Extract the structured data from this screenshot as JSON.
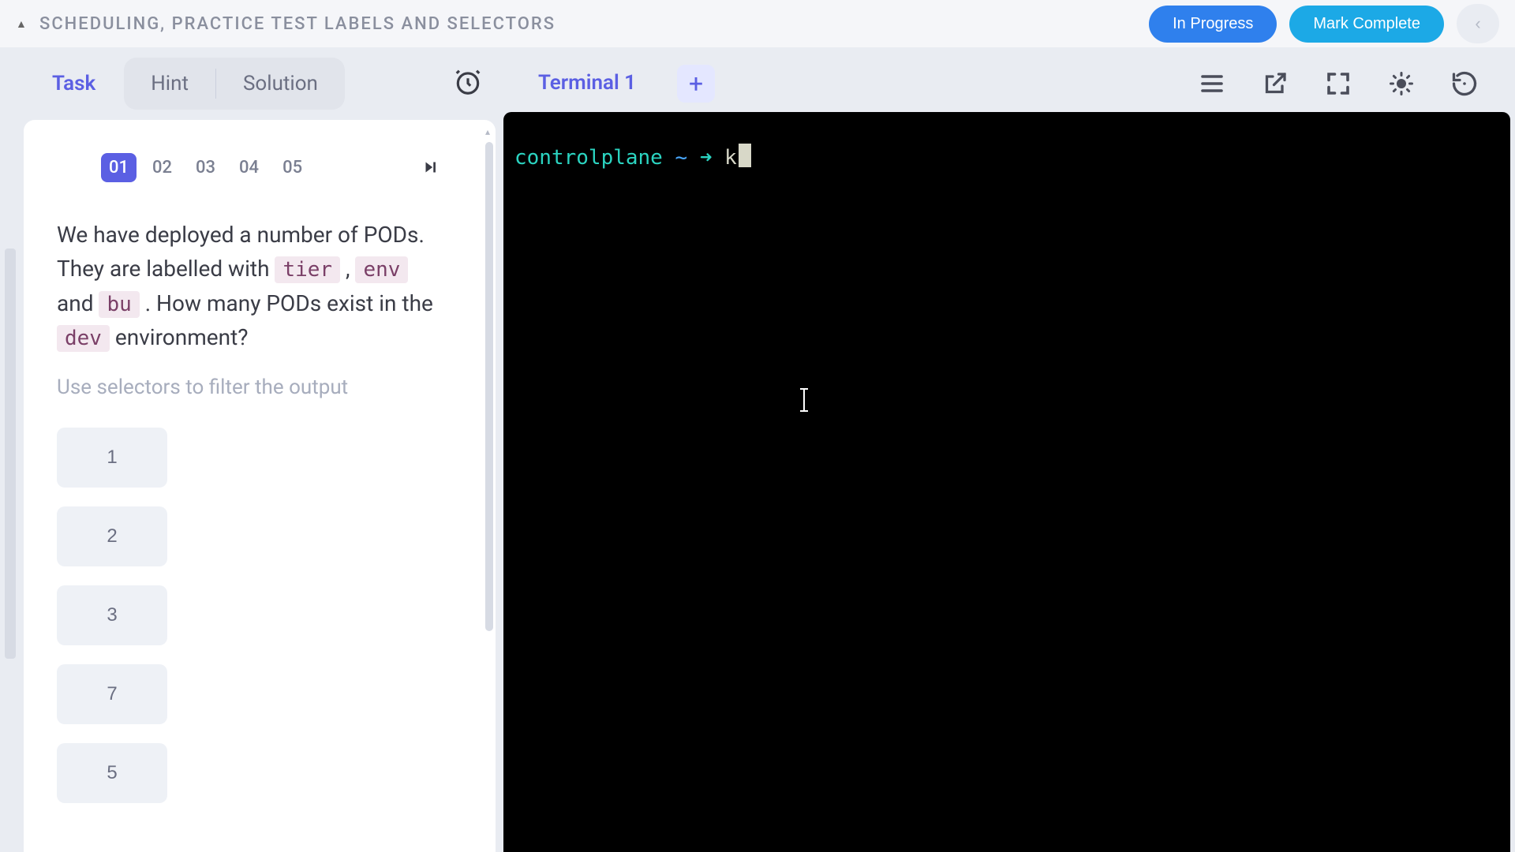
{
  "header": {
    "breadcrumb": "SCHEDULING, PRACTICE TEST LABELS AND SELECTORS",
    "status_label": "In Progress",
    "complete_label": "Mark Complete"
  },
  "task_tabs": {
    "task": "Task",
    "hint": "Hint",
    "solution": "Solution"
  },
  "steps": [
    "01",
    "02",
    "03",
    "04",
    "05"
  ],
  "active_step_index": 0,
  "question": {
    "line1a": "We have deployed a number of PODs. They are labelled with ",
    "code1": "tier",
    "sep1": " , ",
    "code2": "env",
    "mid": " and ",
    "code3": "bu",
    "after3": " . How many PODs exist in the ",
    "code4": "dev",
    "tail": " environment?",
    "hint": "Use selectors to filter the output"
  },
  "answers": [
    "1",
    "2",
    "3",
    "7",
    "5"
  ],
  "terminal": {
    "tab_label": "Terminal 1",
    "prompt_host": "controlplane",
    "prompt_path": "~",
    "prompt_arrow": "➜",
    "typed": "k"
  }
}
